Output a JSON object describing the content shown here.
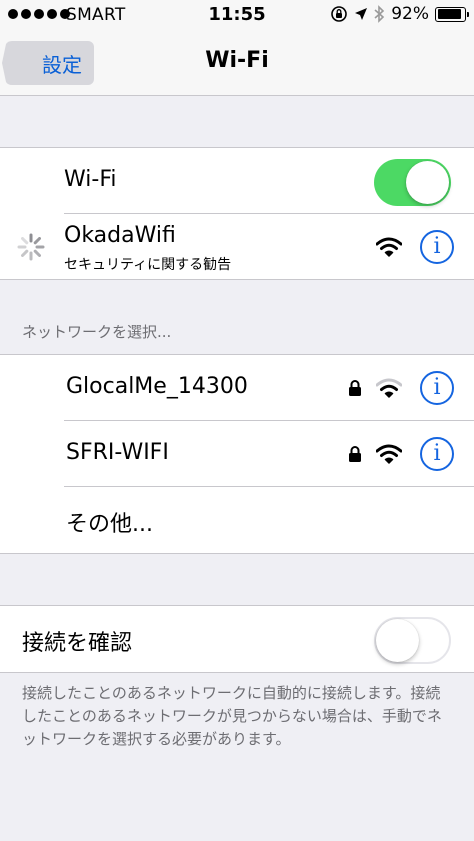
{
  "status_bar": {
    "carrier": "SMART",
    "time": "11:55",
    "battery_percent": "92%",
    "battery_level": 0.92
  },
  "nav": {
    "back_label": "設定",
    "title": "Wi-Fi"
  },
  "wifi": {
    "label": "Wi-Fi",
    "enabled": true
  },
  "current_network": {
    "name": "OkadaWifi",
    "subtitle": "セキュリティに関する勧告"
  },
  "network_section": {
    "header": "ネットワークを選択...",
    "networks": [
      {
        "name": "GlocalMe_14300",
        "secured": true,
        "signal": "medium"
      },
      {
        "name": "SFRI-WIFI",
        "secured": true,
        "signal": "full"
      }
    ],
    "other_label": "その他..."
  },
  "ask_to_join": {
    "label": "接続を確認",
    "enabled": false,
    "footer": "接続したことのあるネットワークに自動的に接続します。接続したことのあるネットワークが見つからない場合は、手動でネットワークを選択する必要があります。"
  },
  "colors": {
    "accent": "#1565e0",
    "toggle_on": "#4cd964",
    "background": "#efeff4"
  }
}
